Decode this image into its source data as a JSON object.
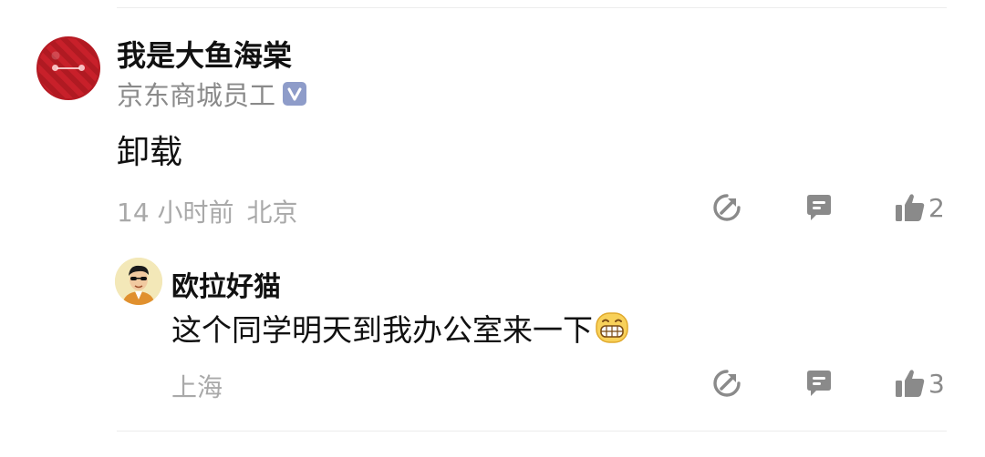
{
  "comment": {
    "author": "我是大鱼海棠",
    "badge": "京东商城员工",
    "badge_icon": "verified-v-icon",
    "content": "卸载",
    "time": "14 小时前",
    "location": "北京",
    "likes": "2",
    "actions": [
      "share-icon",
      "comment-icon",
      "thumbs-up-icon"
    ]
  },
  "reply": {
    "author": "欧拉好猫",
    "content": "这个同学明天到我办公室来一下",
    "emoji": "grin-emoji",
    "location": "上海",
    "likes": "3",
    "actions": [
      "share-icon",
      "comment-icon",
      "thumbs-up-icon"
    ]
  },
  "colors": {
    "icon": "#8a8a8a",
    "meta_text": "#a9a9a9",
    "badge": "#8e9cc9"
  }
}
